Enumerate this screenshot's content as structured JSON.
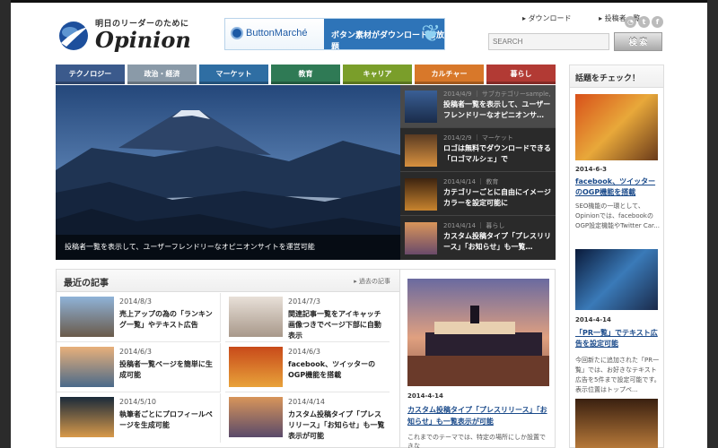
{
  "header": {
    "tagline": "明日のリーダーのために",
    "logo_text": "Opinion",
    "banner": {
      "brand": "ButtonMarché",
      "message": "ボタン素材がダウンロードし放題"
    },
    "links": [
      "ダウンロード",
      "投稿者一覧"
    ],
    "social_icons": [
      "rss-icon",
      "twitter-icon",
      "facebook-icon"
    ],
    "search_placeholder": "SEARCH",
    "search_button": "検 索"
  },
  "nav": {
    "tabs": [
      {
        "label": "テクノロジー",
        "color": "#3b5a8c"
      },
      {
        "label": "政治・経済",
        "color": "#8a9aa8"
      },
      {
        "label": "マーケット",
        "color": "#2f6ea3"
      },
      {
        "label": "教育",
        "color": "#2f7a55"
      },
      {
        "label": "キャリア",
        "color": "#7a9e2a"
      },
      {
        "label": "カルチャー",
        "color": "#d8782a"
      },
      {
        "label": "暮らし",
        "color": "#b23a34"
      }
    ]
  },
  "hero": {
    "caption": "投稿者一覧を表示して、ユーザーフレンドリーなオピニオンサイトを運営可能",
    "items": [
      {
        "meta": "2014/4/9 ｜ サブカテゴリーsample, 政治・経済",
        "title": "投稿者一覧を表示して、ユーザーフレンドリーなオピニオンサ…"
      },
      {
        "meta": "2014/2/9 ｜ マーケット",
        "title": "ロゴは無料でダウンロードできる「ロゴマルシェ」で"
      },
      {
        "meta": "2014/4/14 ｜ 教育",
        "title": "カテゴリーごとに自由にイメージカラーを設定可能に"
      },
      {
        "meta": "2014/4/14 ｜ 暮らし",
        "title": "カスタム投稿タイプ「プレスリリース」「お知らせ」も一覧…"
      }
    ]
  },
  "recent": {
    "title": "最近の記事",
    "past_link": "過去の記事",
    "items": [
      {
        "date": "2014/8/3",
        "title": "売上アップの為の「ランキング一覧」やテキスト広告"
      },
      {
        "date": "2014/7/3",
        "title": "関連記事一覧をアイキャッチ画像つきでページ下部に自動表示"
      },
      {
        "date": "2014/6/3",
        "title": "投稿者一覧ページを簡単に生成可能"
      },
      {
        "date": "2014/6/3",
        "title": "facebook、ツイッターのOGP機能を搭載"
      },
      {
        "date": "2014/5/10",
        "title": "執筆者ごとにプロフィールページを生成可能"
      },
      {
        "date": "2014/4/14",
        "title": "カスタム投稿タイプ「プレスリリース」「お知らせ」も一覧表示が可能"
      }
    ]
  },
  "feature": {
    "date": "2014-4-14",
    "title": "カスタム投稿タイプ「プレスリリース」「お知らせ」も一覧表示が可能",
    "excerpt": "これまでのテーマでは、特定の場所にしか設置できな"
  },
  "sidebar": {
    "title": "話題をチェック！",
    "items": [
      {
        "date": "2014-6-3",
        "title": "facebook、ツイッターのOGP機能を搭載",
        "excerpt": "SEO機能の一環として、Opinionでは、facebookのOGP設定機能やTwitter Car..."
      },
      {
        "date": "2014-4-14",
        "title": "「PR一覧」でテキスト広告を設定可能",
        "excerpt": "今回新たに追加された「PR一覧」では、お好きなテキスト広告を5件まで設定可能です。表示位置はトップペ..."
      }
    ]
  }
}
